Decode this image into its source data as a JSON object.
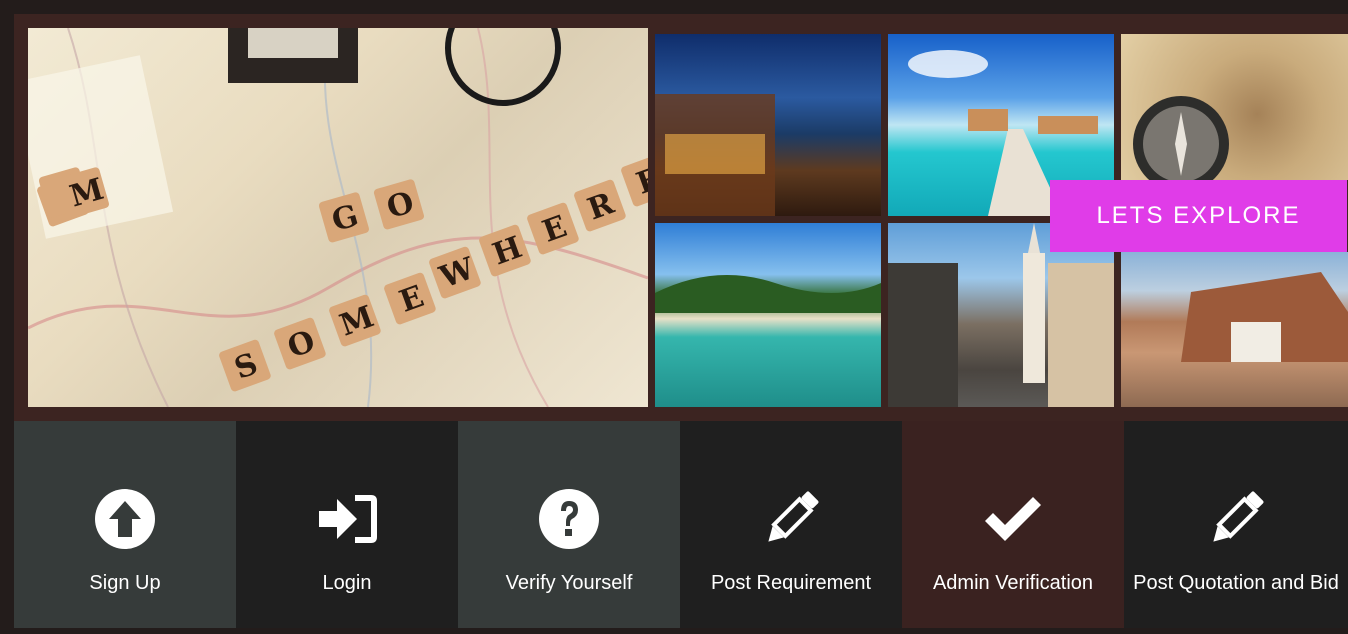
{
  "banner": {
    "cta_label": "LETS EXPLORE",
    "hero_tiles": [
      "G",
      "O",
      "S",
      "O",
      "M",
      "E",
      "W",
      "H",
      "E",
      "R",
      "E"
    ],
    "accent_color": "#e03ce8"
  },
  "actions": [
    {
      "label": "Sign Up",
      "icon": "arrow-up-circle-icon",
      "bg": "#363b3a"
    },
    {
      "label": "Login",
      "icon": "sign-in-icon",
      "bg": "#1f1f1f"
    },
    {
      "label": "Verify Yourself",
      "icon": "question-circle-icon",
      "bg": "#363b3a"
    },
    {
      "label": "Post Requirement",
      "icon": "pencil-icon",
      "bg": "#1f1f1f"
    },
    {
      "label": "Admin Verification",
      "icon": "check-icon",
      "bg": "#3a2220"
    },
    {
      "label": "Post Quotation and Bid",
      "icon": "pencil-icon",
      "bg": "#1f1f1f"
    }
  ]
}
